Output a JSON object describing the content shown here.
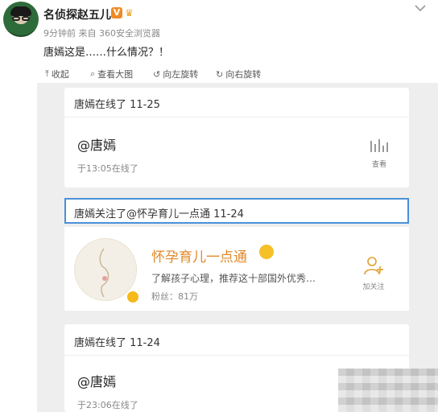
{
  "post": {
    "username": "名侦探赵五儿",
    "verified_badge": "V",
    "meta": "9分钟前 来自 360安全浏览器",
    "text": "唐嫣这是……什么情况？！"
  },
  "toolbar": {
    "collapse": "收起",
    "view_large": "查看大图",
    "rotate_left": "向左旋转",
    "rotate_right": "向右旋转"
  },
  "screenshot": {
    "card1": {
      "title": "唐嫣在线了 11-25",
      "mention": "@唐嫣",
      "time": "于13:05在线了",
      "view_label": "查看"
    },
    "follow_bar": "唐嫣关注了@怀孕育儿一点通 11-24",
    "account": {
      "name": "怀孕育儿一点通",
      "description": "了解孩子心理，推荐这十部国外优秀…",
      "fans": "粉丝：81万",
      "follow_label": "加关注"
    },
    "card3": {
      "title": "唐嫣在线了 11-24",
      "mention": "@唐嫣",
      "time": "于23:06在线了"
    }
  },
  "colors": {
    "highlight_border": "#4a90d9",
    "account_name": "#e08a2a",
    "badge": "#f08a24"
  }
}
